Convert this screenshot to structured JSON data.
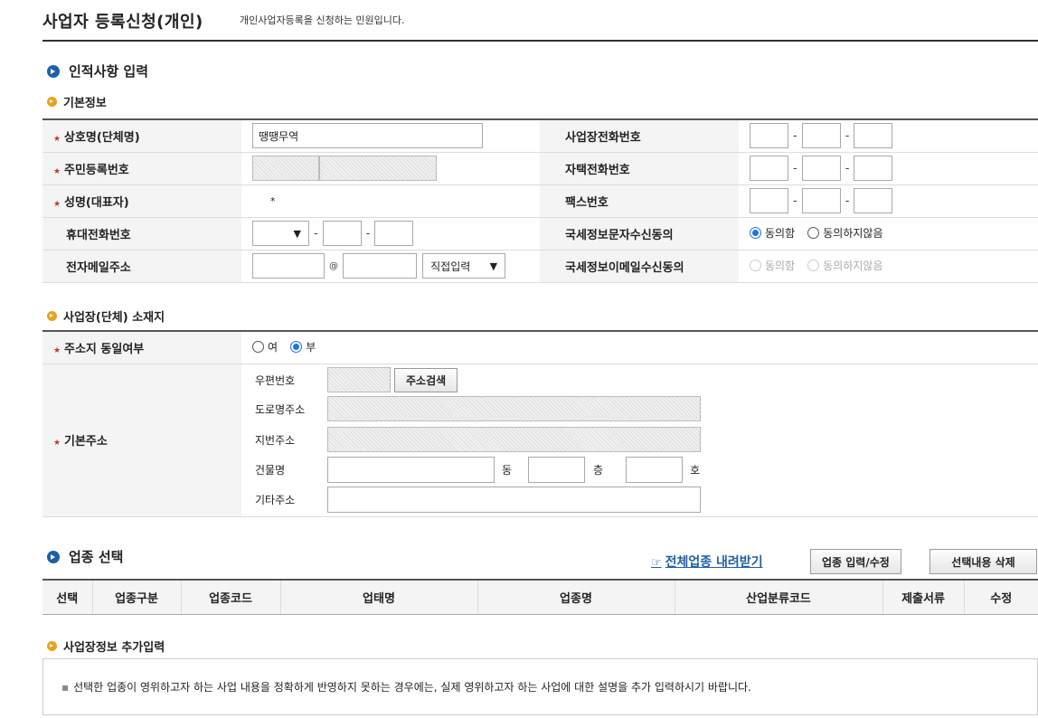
{
  "header": {
    "title": "사업자 등록신청(개인)",
    "subtitle": "개인사업자등록을 신청하는 민원입니다."
  },
  "section1": {
    "title": "인적사항 입력",
    "sub_basic": "기본정보",
    "company_name": {
      "label": "상호명(단체명)",
      "value": "땡땡무역"
    },
    "resident_no": {
      "label": "주민등록번호"
    },
    "rep_name": {
      "label": "성명(대표자)",
      "value": "*"
    },
    "mobile": {
      "label": "휴대전화번호"
    },
    "email": {
      "label": "전자메일주소",
      "at": "@",
      "domain_select": "직접입력"
    },
    "biz_phone": {
      "label": "사업장전화번호"
    },
    "home_phone": {
      "label": "자택전화번호"
    },
    "fax": {
      "label": "팩스번호"
    },
    "sms_consent": {
      "label": "국세정보문자수신동의",
      "agree": "동의함",
      "disagree": "동의하지않음"
    },
    "email_consent": {
      "label": "국세정보이메일수신동의",
      "agree": "동의함",
      "disagree": "동의하지않음"
    }
  },
  "section_addr": {
    "title": "사업장(단체) 소재지",
    "same_addr": {
      "label": "주소지 동일여부",
      "yes": "여",
      "no": "부"
    },
    "base_addr": {
      "label": "기본주소",
      "zip_label": "우편번호",
      "search_button": "주소검색",
      "road_label": "도로명주소",
      "lot_label": "지번주소",
      "building_label": "건물명",
      "dong": "동",
      "floor": "층",
      "ho": "호",
      "etc_label": "기타주소"
    }
  },
  "section_biz": {
    "title": "업종 선택",
    "download_link": "전체업종 내려받기",
    "edit_button": "업종 입력/수정",
    "delete_button": "선택내용 삭제",
    "columns": [
      "선택",
      "업종구분",
      "업종코드",
      "업태명",
      "업종명",
      "산업분류코드",
      "제출서류",
      "수정"
    ]
  },
  "section_extra": {
    "title": "사업장정보 추가입력",
    "notice": "선택한 업종이 영위하고자 하는 사업 내용을 정확하게 반영하지 못하는 경우에는, 실제 영위하고자 하는 사업에 대한 설명을 추가 입력하시기 바랍니다."
  },
  "colors": {
    "accent_blue": "#1f5fa8",
    "bullet_orange": "#e8a31a",
    "required_red": "#c0392b"
  }
}
